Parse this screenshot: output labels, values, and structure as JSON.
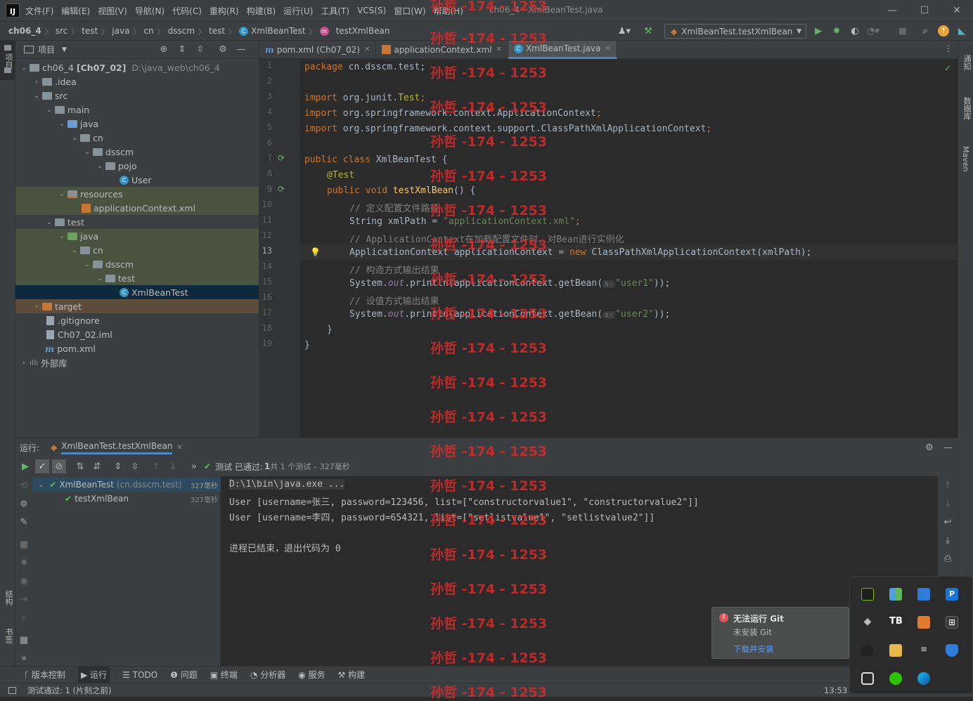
{
  "menubar": {
    "logo": "IJ",
    "items": [
      "文件(F)",
      "编辑(E)",
      "视图(V)",
      "导航(N)",
      "代码(C)",
      "重构(R)",
      "构建(B)",
      "运行(U)",
      "工具(T)",
      "VCS(S)",
      "窗口(W)",
      "帮助(H)"
    ],
    "window_title": "ch06_4 - XmlBeanTest.java"
  },
  "navbar": {
    "breadcrumb": [
      "ch06_4",
      "src",
      "test",
      "java",
      "cn",
      "dsscm",
      "test",
      "XmlBeanTest",
      "testXmlBean"
    ],
    "run_config": "XmlBeanTest.testXmlBean"
  },
  "left_stripe": {
    "project": "项目",
    "structure": "结构",
    "bookmarks": "书签"
  },
  "right_stripe": {
    "notifications": "通知",
    "database": "数据库",
    "maven": "Maven"
  },
  "project": {
    "title": "项目",
    "tree": [
      {
        "label": "ch06_4",
        "bold": "[Ch07_02]",
        "path": "D:\\java_web\\ch06_4"
      },
      {
        "label": ".idea"
      },
      {
        "label": "src"
      },
      {
        "label": "main"
      },
      {
        "label": "java"
      },
      {
        "label": "cn"
      },
      {
        "label": "dsscm"
      },
      {
        "label": "pojo"
      },
      {
        "label": "User"
      },
      {
        "label": "resources"
      },
      {
        "label": "applicationContext.xml"
      },
      {
        "label": "test"
      },
      {
        "label": "java"
      },
      {
        "label": "cn"
      },
      {
        "label": "dsscm"
      },
      {
        "label": "test"
      },
      {
        "label": "XmlBeanTest"
      },
      {
        "label": "target"
      },
      {
        "label": ".gitignore"
      },
      {
        "label": "Ch07_02.iml"
      },
      {
        "label": "pom.xml"
      },
      {
        "label": "外部库"
      }
    ]
  },
  "editor": {
    "tabs": [
      {
        "label": "pom.xml (Ch07_02)",
        "active": false
      },
      {
        "label": "applicationContext.xml",
        "active": false
      },
      {
        "label": "XmlBeanTest.java",
        "active": true
      }
    ],
    "line_numbers": [
      "1",
      "2",
      "3",
      "4",
      "5",
      "6",
      "7",
      "8",
      "9",
      "10",
      "11",
      "12",
      "13",
      "14",
      "15",
      "16",
      "17",
      "18",
      "19"
    ],
    "code": {
      "l1_kw": "package",
      "l1_rest": " cn.dsscm.test;",
      "l3_kw": "import",
      "l3_rest": " org.junit.",
      "l3_cls": "Test",
      "l3_end": ";",
      "l4_kw": "import",
      "l4_rest": " org.springframework.context.ApplicationContext",
      "l5_kw": "import",
      "l5_rest": " org.springframework.context.support.ClassPathXmlApplicationContext",
      "semicolon": ";",
      "l7_kw": "public class",
      "l7_rest": " XmlBeanTest {",
      "l8_ann": "@Test",
      "l9_kw": "public void",
      "l9_mth": " testXmlBean",
      "l9_rest": "() {",
      "l10_cmt": "// 定义配置文件路径",
      "l11_a": "String xmlPath = ",
      "l11_str": "\"applicationContext.xml\"",
      "l11_end": ";",
      "l12_cmt": "// ApplicationContext在加载配置文件时，对Bean进行实例化",
      "l13_a": "ApplicationContext applicationContext = ",
      "l13_kw": "new",
      "l13_b": " ClassPathXmlApplicationContext(xmlPath);",
      "l14_cmt": "// 构造方式输出结果",
      "l15_a": "System.",
      "l15_fld": "out",
      "l15_b": ".println(applicationContext.getBean(",
      "l15_hint": "s:",
      "l15_str": "\"user1\"",
      "l15_end": "));",
      "l16_cmt": "// 设值方式输出结果",
      "l17_a": "System.",
      "l17_fld": "out",
      "l17_b": ".println(applicationContext.getBean(",
      "l17_hint": "s:",
      "l17_str": "\"user2\"",
      "l17_end": "));",
      "l18": "}",
      "l19": "}"
    }
  },
  "watermark": "孙哲 -174 - 1253",
  "run": {
    "label": "运行:",
    "tab": "XmlBeanTest.testXmlBean",
    "status_prefix": "测试 已通过:",
    "status_count": "1",
    "status_rest": "共 1 个测试 – 327毫秒",
    "tests": [
      {
        "name": "XmlBeanTest",
        "pkg": "(cn.dsscm.test)",
        "time": "327毫秒"
      },
      {
        "name": "testXmlBean",
        "time": "327毫秒"
      }
    ],
    "console": [
      "D:\\1\\bin\\java.exe ...",
      "User [username=张三, password=123456, list=[\"constructorvalue1\", \"constructorvalue2\"]]",
      "User [username=李四, password=654321, list=[\"setlistvalue1\", \"setlistvalue2\"]]",
      "",
      "进程已结束，退出代码为 0"
    ]
  },
  "bottom_tabs": [
    "版本控制",
    "运行",
    "TODO",
    "问题",
    "终端",
    "分析器",
    "服务",
    "构建"
  ],
  "status": {
    "left": "测试通过: 1 (片刻之前)",
    "time": "13:53"
  },
  "notification": {
    "title": "无法运行 Git",
    "body": "未安装 Git",
    "link": "下载并安装"
  },
  "colors": {
    "accent": "#4a88c7",
    "pass": "#5fb85f",
    "error": "#e05555",
    "watermark": "#d62a2a"
  }
}
